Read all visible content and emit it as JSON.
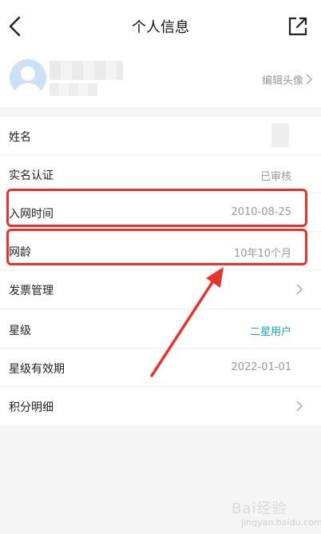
{
  "header": {
    "title": "个人信息",
    "back_icon": "back-arrow-icon",
    "share_icon": "share-icon"
  },
  "profile": {
    "edit_avatar_label": "编辑头像"
  },
  "section1": {
    "rows": [
      {
        "label": "姓名",
        "value": ""
      },
      {
        "label": "实名认证",
        "value": "已审核"
      },
      {
        "label": "入网时间",
        "value": "2010-08-25"
      },
      {
        "label": "网龄",
        "value": "10年10个月"
      },
      {
        "label": "发票管理",
        "value": ""
      }
    ]
  },
  "section2": {
    "rows": [
      {
        "label": "星级",
        "value": "二星用户"
      },
      {
        "label": "星级有效期",
        "value": "2022-01-01"
      },
      {
        "label": "积分明细",
        "value": ""
      }
    ]
  },
  "colors": {
    "accent": "#1aa7b8",
    "annotation": "#e8332d",
    "background": "#f5f5f5"
  },
  "watermark": {
    "text": "Bai经验",
    "sub": "jingyan.baidu.com"
  }
}
